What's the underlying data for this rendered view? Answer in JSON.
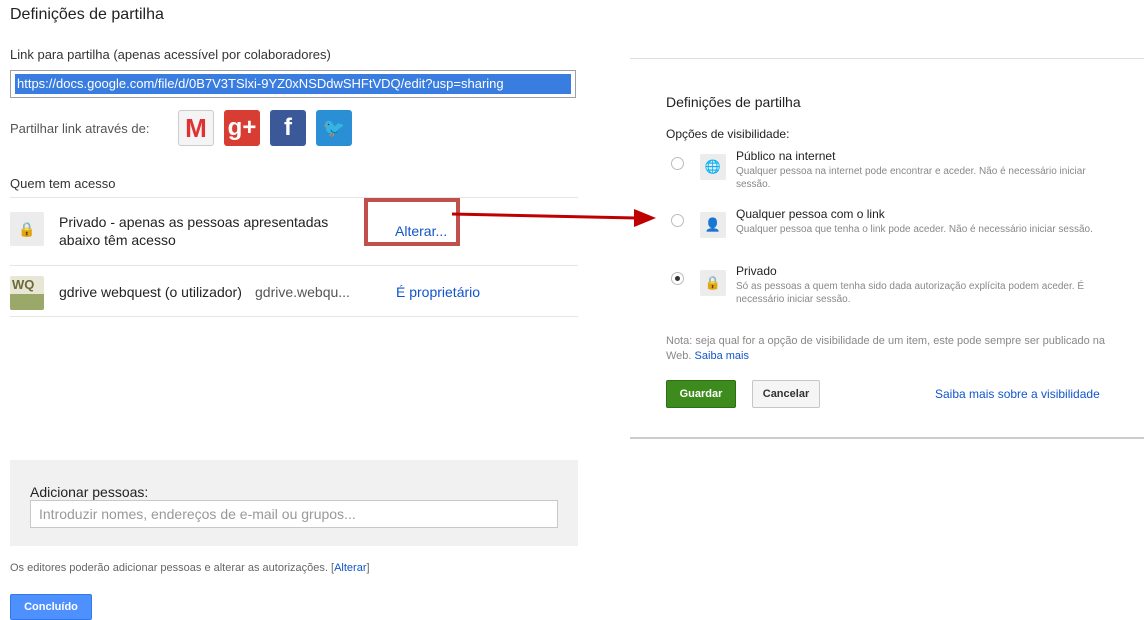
{
  "left": {
    "title": "Definições de partilha",
    "link_label": "Link para partilha (apenas acessível por colaboradores)",
    "link_value": "https://docs.google.com/file/d/0B7V3TSlxi-9YZ0xNSDdwSHFtVDQ/edit?usp=sharing",
    "share_label": "Partilhar link através de:",
    "social": [
      {
        "icon": "gmail-icon",
        "glyph": "M"
      },
      {
        "icon": "google-plus-icon",
        "glyph": "g+"
      },
      {
        "icon": "facebook-icon",
        "glyph": "f"
      },
      {
        "icon": "twitter-icon",
        "glyph": "🐦"
      }
    ],
    "who_label": "Quem tem acesso",
    "access_rows": [
      {
        "text": "Privado - apenas as pessoas apresentadas abaixo têm acesso",
        "action": "Alterar..."
      },
      {
        "name": "gdrive webquest (o utilizador)",
        "email": "gdrive.webqu...",
        "role": "É proprietário",
        "avatar_text": "WQ"
      }
    ],
    "add_label": "Adicionar pessoas:",
    "add_placeholder": "Introduzir nomes, endereços de e-mail ou grupos...",
    "editors_note": "Os editores poderão adicionar pessoas e alterar as autorizações.",
    "editors_link": "Alterar",
    "done_label": "Concluído"
  },
  "right": {
    "title": "Definições de partilha",
    "visibility_label": "Opções de visibilidade:",
    "options": [
      {
        "title": "Público na internet",
        "desc": "Qualquer pessoa na internet pode encontrar e aceder. Não é necessário iniciar sessão.",
        "icon": "globe-icon",
        "selected": false
      },
      {
        "title": "Qualquer pessoa com o link",
        "desc": "Qualquer pessoa que tenha o link pode aceder. Não é necessário iniciar sessão.",
        "icon": "person-link-icon",
        "selected": false
      },
      {
        "title": "Privado",
        "desc": "Só as pessoas a quem tenha sido dada autorização explícita podem aceder. É necessário iniciar sessão.",
        "icon": "lock-icon",
        "selected": true
      }
    ],
    "note": "Nota: seja qual for a opção de visibilidade de um item, este pode sempre ser publicado na Web.",
    "note_link": "Saiba mais",
    "save_label": "Guardar",
    "cancel_label": "Cancelar",
    "learn_more": "Saiba mais sobre a visibilidade"
  },
  "colors": {
    "highlight": "#c0504d",
    "arrow": "#c00000",
    "link": "#1155cc",
    "save": "#3d8b1c",
    "done": "#4d90fe"
  }
}
